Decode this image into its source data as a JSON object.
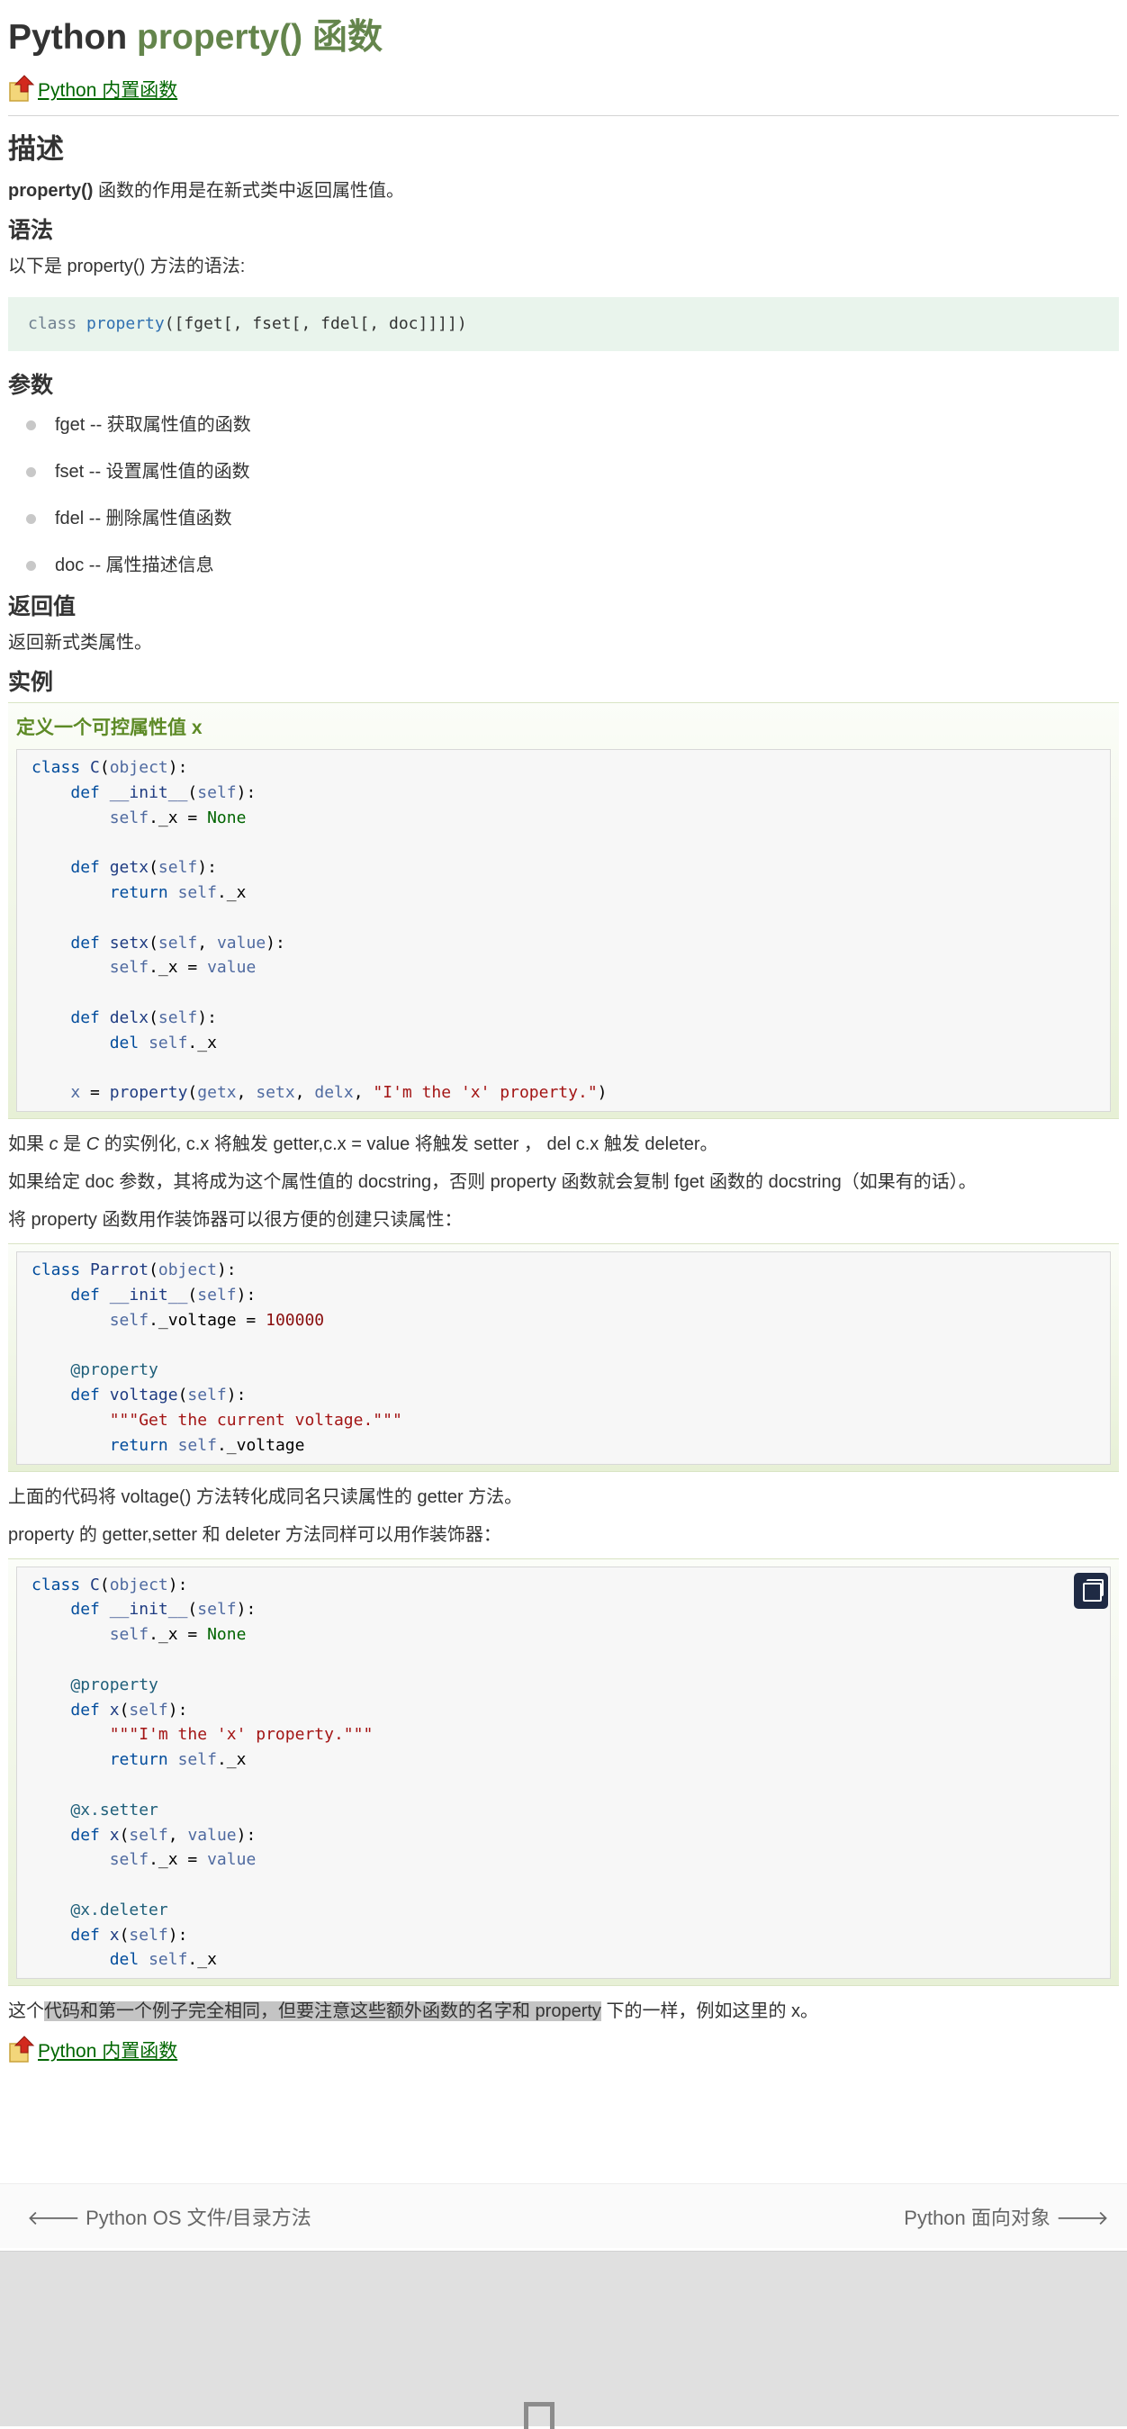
{
  "page": {
    "title_prefix": "Python ",
    "title_highlight": "property() 函数",
    "back_link": "Python 内置函数"
  },
  "sections": {
    "desc_heading": "描述",
    "desc_bold": "property()",
    "desc_text": " 函数的作用是在新式类中返回属性值。",
    "syntax_heading": "语法",
    "syntax_intro": "以下是 property() 方法的语法:",
    "syntax_kw": "class",
    "syntax_fn": "property",
    "syntax_args": "([fget[, fset[, fdel[, doc]]]])",
    "params_heading": "参数",
    "params": [
      "fget -- 获取属性值的函数",
      "fset -- 设置属性值的函数",
      "fdel -- 删除属性值函数",
      "doc -- 属性描述信息"
    ],
    "return_heading": "返回值",
    "return_text": "返回新式类属性。",
    "example_heading": "实例",
    "example_title": "定义一个可控属性值 x"
  },
  "paragraphs": {
    "p1_a": "如果 ",
    "p1_c": "c",
    "p1_b": " 是 ",
    "p1_C": "C",
    "p1_rest": " 的实例化, c.x 将触发 getter,c.x = value 将触发 setter ， del c.x 触发 deleter。",
    "p2": "如果给定 doc 参数，其将成为这个属性值的 docstring，否则 property 函数就会复制 fget 函数的 docstring（如果有的话）。",
    "p3": "将 property 函数用作装饰器可以很方便的创建只读属性：",
    "p4": "上面的代码将 voltage() 方法转化成同名只读属性的 getter 方法。",
    "p5": "property 的 getter,setter 和 deleter 方法同样可以用作装饰器：",
    "p6_a": "这个",
    "p6_sel": "代码和第一个例子完全相同，但要注意这些额外函数的名字和 property",
    "p6_b": " 下的一样，例如这里的 x。"
  },
  "nav": {
    "prev": "Python OS 文件/目录方法",
    "next": "Python 面向对象"
  },
  "icons": {
    "back": "back-arrow-icon",
    "copy": "copy-icon",
    "prev": "arrow-left-icon",
    "next": "arrow-right-icon",
    "doc": "document-icon"
  },
  "colors": {
    "title_highlight": "#64854c",
    "link": "#006600",
    "syntax_bg": "#e9f4ec",
    "example_title": "#5d8a26"
  }
}
